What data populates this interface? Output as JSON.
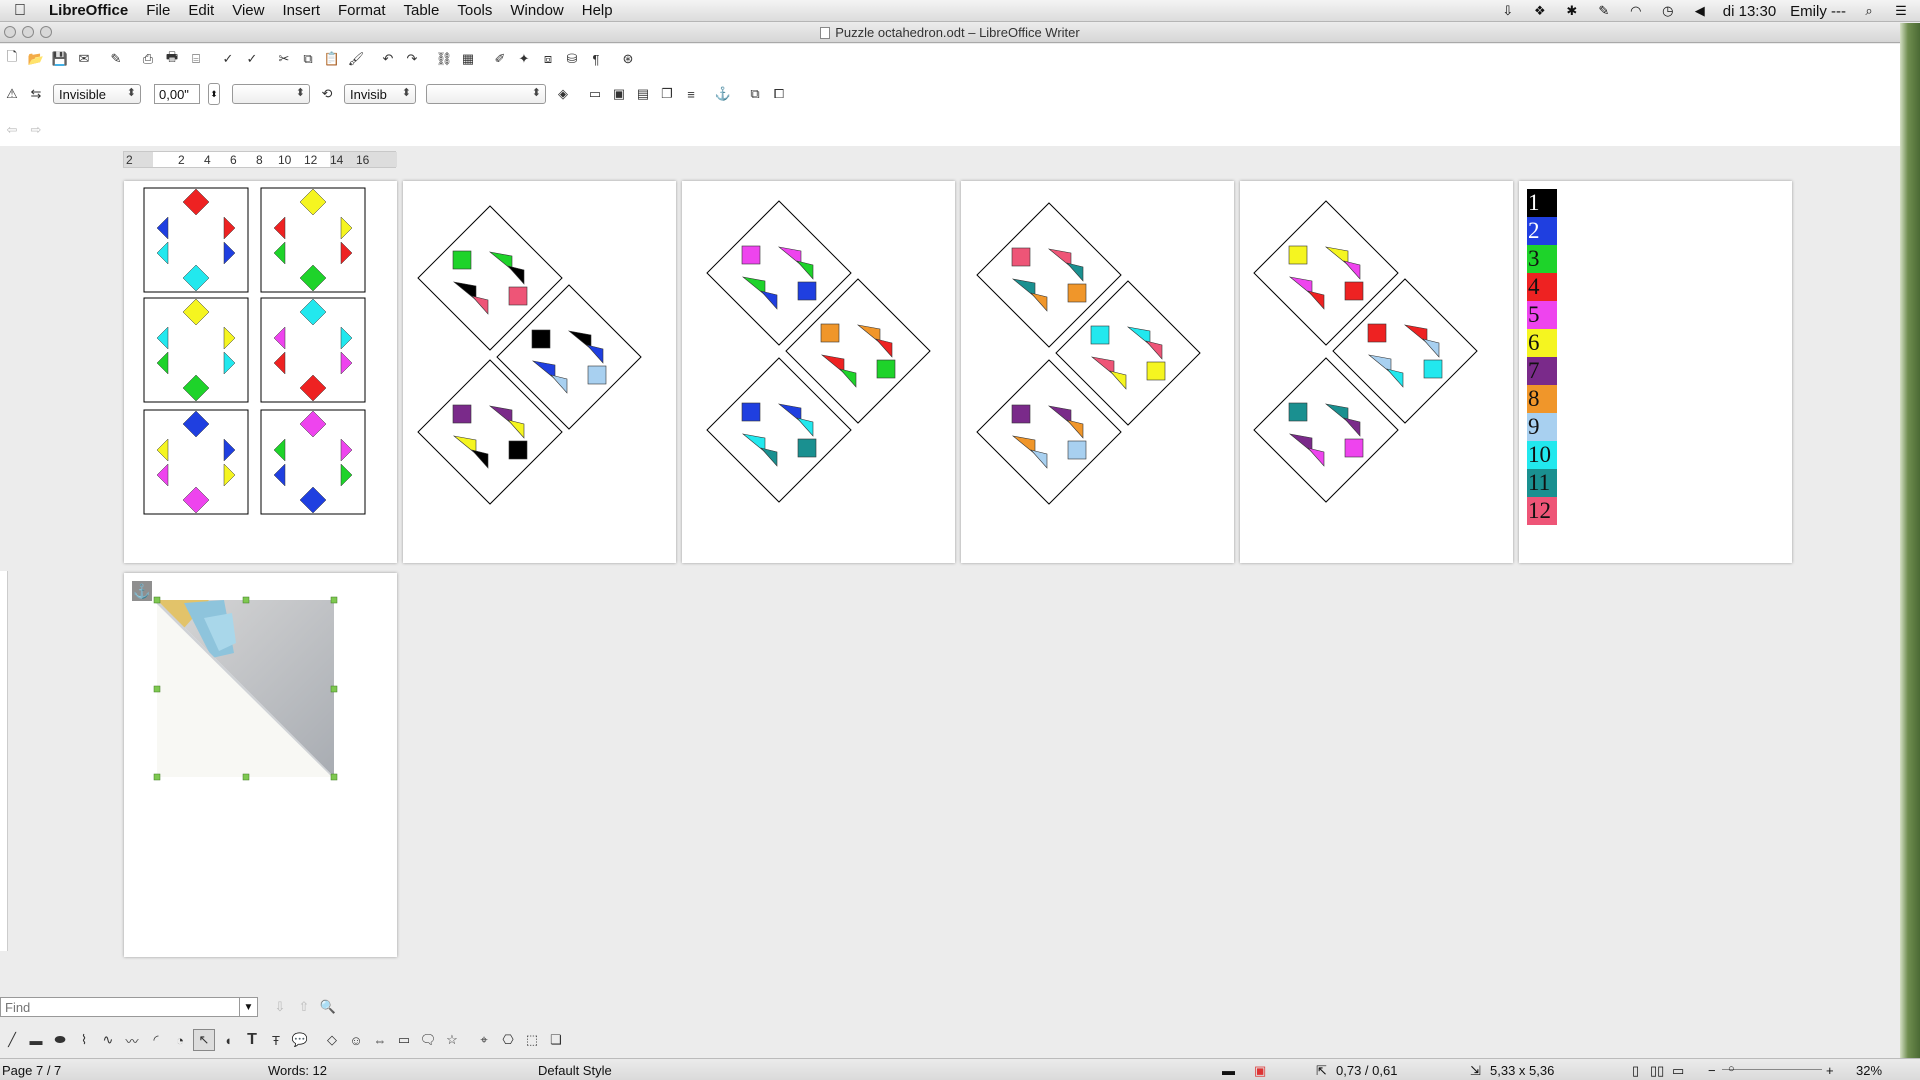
{
  "menubar": {
    "app": "LibreOffice",
    "items": [
      "File",
      "Edit",
      "View",
      "Insert",
      "Format",
      "Table",
      "Tools",
      "Window",
      "Help"
    ],
    "clock": "di 13:30",
    "user": "Emily ---"
  },
  "window": {
    "title": "Puzzle octahedron.odt – LibreOffice Writer"
  },
  "frame_toolbar": {
    "border_style": "Invisible",
    "border_width": "0,00\"",
    "border_color": "",
    "shadow_style": "Invisib",
    "shadow_color": ""
  },
  "ruler": {
    "ticks": [
      "2",
      "2",
      "4",
      "6",
      "8",
      "10",
      "12",
      "14",
      "16"
    ]
  },
  "colors": {
    "c1": "#000000",
    "c2": "#1f3fe0",
    "c3": "#1ed32a",
    "c4": "#ee2222",
    "c5": "#ee44ee",
    "c6": "#f5f520",
    "c7": "#7a2a8a",
    "c8": "#f0962a",
    "c9": "#a8d0f0",
    "c10": "#22e8ee",
    "c11": "#1a9090",
    "c12": "#ee5577"
  },
  "legend": [
    "1",
    "2",
    "3",
    "4",
    "5",
    "6",
    "7",
    "8",
    "9",
    "10",
    "11",
    "12"
  ],
  "find": {
    "placeholder": "Find"
  },
  "status": {
    "page": "Page 7 / 7",
    "words": "Words: 12",
    "style": "Default Style",
    "position": "0,73 / 0,61",
    "size": "5,33 x 5,36",
    "zoom": "32%"
  }
}
